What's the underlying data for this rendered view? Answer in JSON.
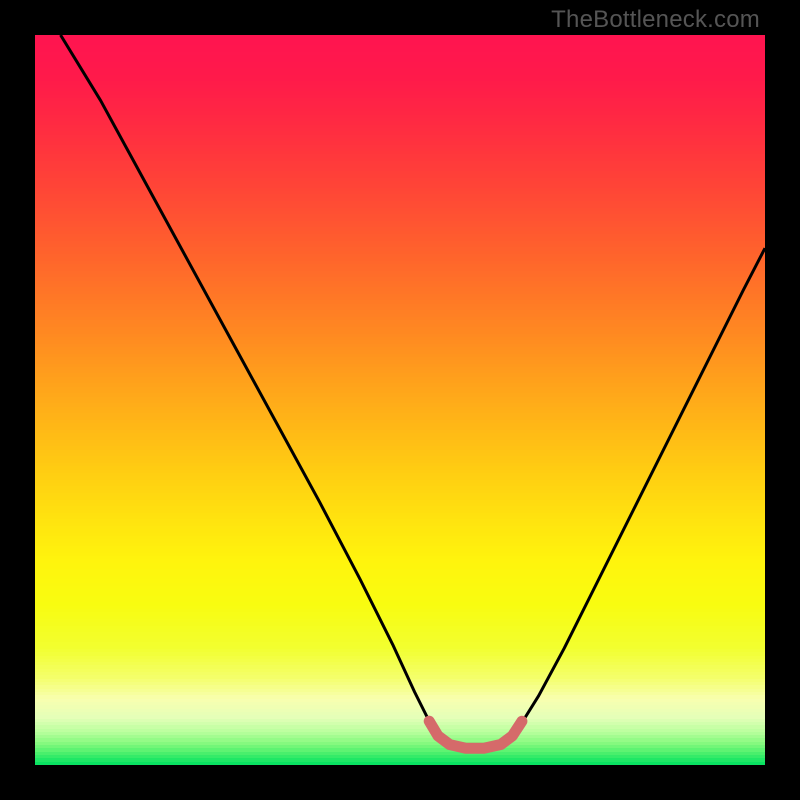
{
  "watermark": "TheBottleneck.com",
  "gradient": {
    "stops": [
      {
        "y": 0.0,
        "color": "#ff1450"
      },
      {
        "y": 0.06,
        "color": "#ff1a4a"
      },
      {
        "y": 0.12,
        "color": "#ff2a42"
      },
      {
        "y": 0.18,
        "color": "#ff3c3a"
      },
      {
        "y": 0.24,
        "color": "#ff4f33"
      },
      {
        "y": 0.3,
        "color": "#ff632c"
      },
      {
        "y": 0.36,
        "color": "#ff7826"
      },
      {
        "y": 0.42,
        "color": "#ff8d20"
      },
      {
        "y": 0.48,
        "color": "#ffa31b"
      },
      {
        "y": 0.54,
        "color": "#ffb916"
      },
      {
        "y": 0.6,
        "color": "#ffce12"
      },
      {
        "y": 0.66,
        "color": "#ffe20f"
      },
      {
        "y": 0.72,
        "color": "#fff40d"
      },
      {
        "y": 0.78,
        "color": "#f8fc10"
      },
      {
        "y": 0.84,
        "color": "#f2ff30"
      },
      {
        "y": 0.88,
        "color": "#f4ff6a"
      },
      {
        "y": 0.91,
        "color": "#f8ffb0"
      },
      {
        "y": 0.935,
        "color": "#e4ffb8"
      },
      {
        "y": 0.955,
        "color": "#b8ff9c"
      },
      {
        "y": 0.972,
        "color": "#80f87c"
      },
      {
        "y": 0.986,
        "color": "#40ee6a"
      },
      {
        "y": 1.0,
        "color": "#00e060"
      }
    ]
  },
  "chart_data": {
    "type": "line",
    "title": "",
    "xlabel": "",
    "ylabel": "",
    "xlim": [
      0,
      1
    ],
    "ylim": [
      0,
      1
    ],
    "series": [
      {
        "name": "bottleneck-curve",
        "stroke": "#000000",
        "stroke_width": 3,
        "points": [
          {
            "x": 0.035,
            "y": 1.0
          },
          {
            "x": 0.09,
            "y": 0.91
          },
          {
            "x": 0.15,
            "y": 0.8
          },
          {
            "x": 0.21,
            "y": 0.69
          },
          {
            "x": 0.27,
            "y": 0.58
          },
          {
            "x": 0.33,
            "y": 0.47
          },
          {
            "x": 0.39,
            "y": 0.36
          },
          {
            "x": 0.445,
            "y": 0.255
          },
          {
            "x": 0.49,
            "y": 0.165
          },
          {
            "x": 0.52,
            "y": 0.1
          },
          {
            "x": 0.545,
            "y": 0.05
          },
          {
            "x": 0.565,
            "y": 0.028
          },
          {
            "x": 0.59,
            "y": 0.02
          },
          {
            "x": 0.615,
            "y": 0.02
          },
          {
            "x": 0.64,
            "y": 0.028
          },
          {
            "x": 0.662,
            "y": 0.05
          },
          {
            "x": 0.69,
            "y": 0.095
          },
          {
            "x": 0.725,
            "y": 0.16
          },
          {
            "x": 0.77,
            "y": 0.25
          },
          {
            "x": 0.82,
            "y": 0.35
          },
          {
            "x": 0.87,
            "y": 0.45
          },
          {
            "x": 0.92,
            "y": 0.55
          },
          {
            "x": 0.97,
            "y": 0.65
          },
          {
            "x": 1.0,
            "y": 0.708
          }
        ]
      },
      {
        "name": "red-floor-highlight",
        "stroke": "#d56a6a",
        "stroke_width": 11,
        "linecap": "round",
        "points": [
          {
            "x": 0.54,
            "y": 0.06
          },
          {
            "x": 0.552,
            "y": 0.04
          },
          {
            "x": 0.568,
            "y": 0.028
          },
          {
            "x": 0.59,
            "y": 0.023
          },
          {
            "x": 0.615,
            "y": 0.023
          },
          {
            "x": 0.638,
            "y": 0.028
          },
          {
            "x": 0.654,
            "y": 0.04
          },
          {
            "x": 0.667,
            "y": 0.06
          }
        ]
      }
    ]
  }
}
